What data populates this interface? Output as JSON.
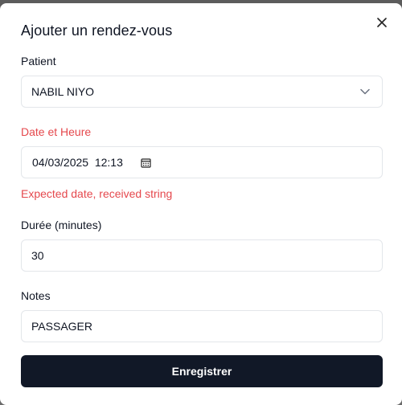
{
  "dialog": {
    "title": "Ajouter un rendez-vous",
    "close_icon": "close-icon"
  },
  "patient": {
    "label": "Patient",
    "value": "NABIL NIYO",
    "icon": "chevron-down-icon"
  },
  "datetime": {
    "label": "Date et Heure",
    "value": "04/03/2025  12:13",
    "icon": "calendar-icon",
    "error": "Expected date, received string",
    "error_color": "#e5484d"
  },
  "duration": {
    "label": "Durée (minutes)",
    "value": "30"
  },
  "notes": {
    "label": "Notes",
    "value": "PASSAGER"
  },
  "submit": {
    "label": "Enregistrer",
    "color": "#111827"
  }
}
